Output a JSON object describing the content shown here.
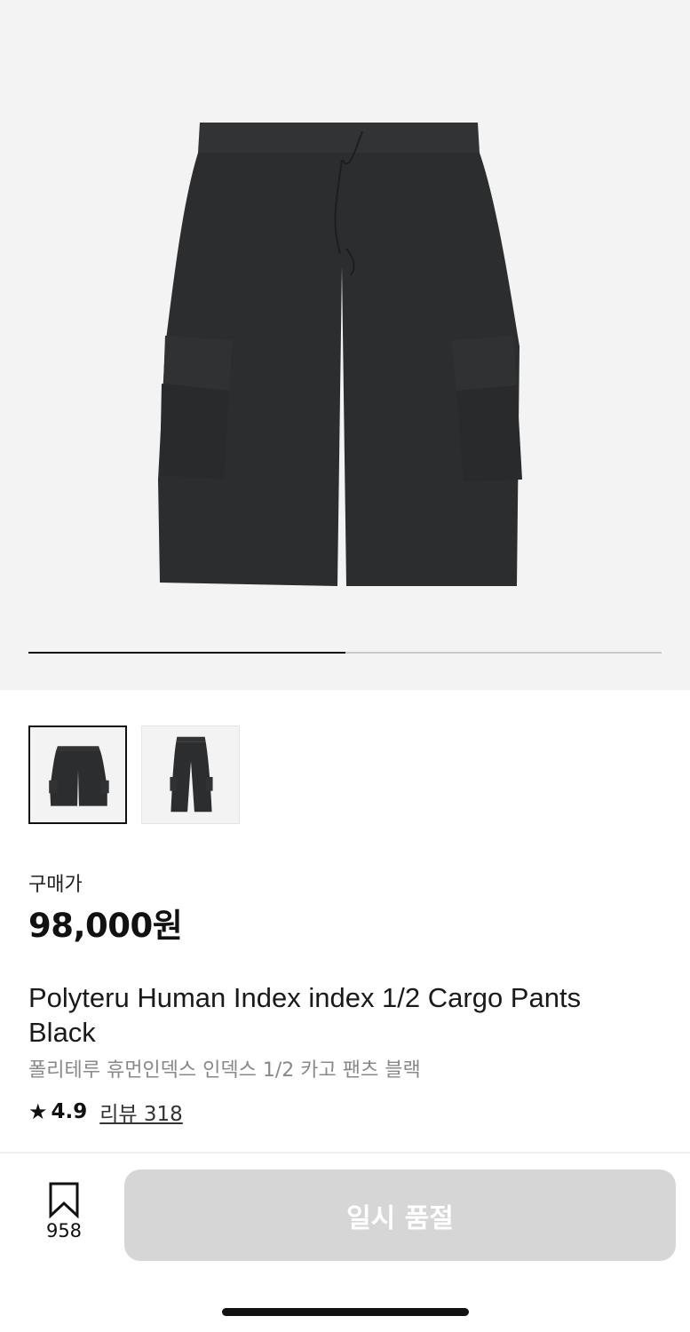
{
  "gallery": {
    "image_count": 2,
    "current_index": 1,
    "thumbnails": [
      {
        "name": "thumbnail-shorts-front"
      },
      {
        "name": "thumbnail-pants-front"
      }
    ]
  },
  "price": {
    "label": "구매가",
    "amount": "98,000원"
  },
  "product": {
    "title_en": "Polyteru Human Index index 1/2 Cargo Pants Black",
    "title_ko": "폴리테루 휴먼인덱스 인덱스 1/2 카고 팬츠 블랙",
    "rating": "4.9",
    "reviews": "리뷰 318",
    "star_icon": "★"
  },
  "bottom_bar": {
    "bookmark_count": "958",
    "buy_label": "일시 품절"
  },
  "colors": {
    "hero_bg": "#f3f3f3",
    "garment": "#2c2d2e",
    "disabled_button": "#d6d6d6"
  }
}
